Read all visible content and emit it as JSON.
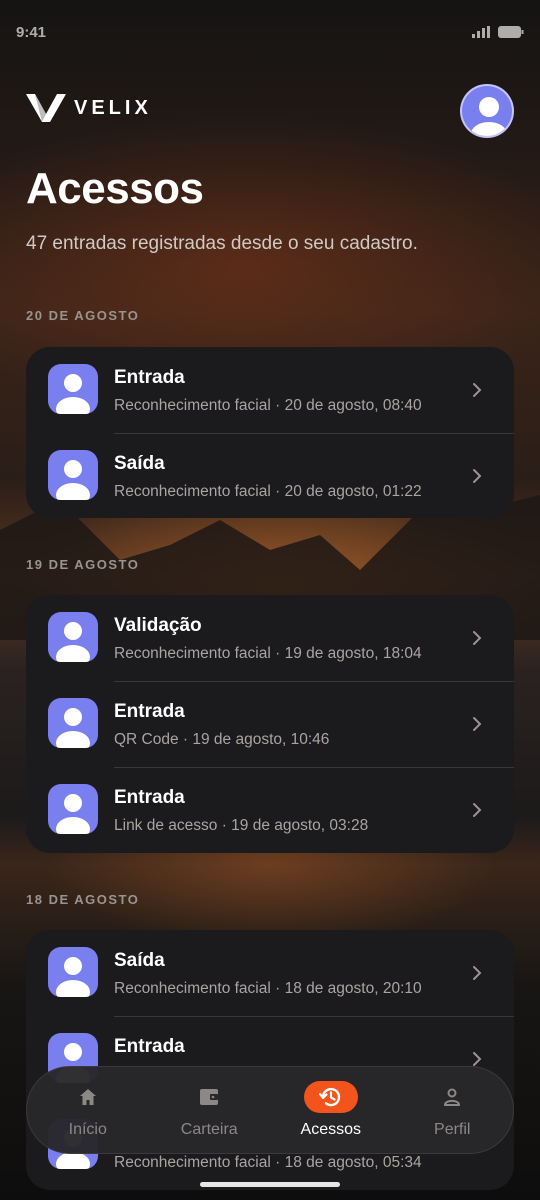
{
  "status": {
    "time": "9:41"
  },
  "brand": {
    "name": "VELIX"
  },
  "header": {
    "title": "Acessos",
    "subtitle": "47 entradas registradas desde o seu cadastro."
  },
  "groups": [
    {
      "label": "20 DE AGOSTO",
      "items": [
        {
          "title": "Entrada",
          "subtitle": "Reconhecimento facial · 20 de agosto, 08:40"
        },
        {
          "title": "Saída",
          "subtitle": "Reconhecimento facial · 20 de agosto, 01:22"
        }
      ]
    },
    {
      "label": "19 DE AGOSTO",
      "items": [
        {
          "title": "Validação",
          "subtitle": "Reconhecimento facial · 19 de agosto, 18:04"
        },
        {
          "title": "Entrada",
          "subtitle": "QR Code · 19 de agosto, 10:46"
        },
        {
          "title": "Entrada",
          "subtitle": "Link de acesso · 19 de agosto, 03:28"
        }
      ]
    },
    {
      "label": "18 DE AGOSTO",
      "items": [
        {
          "title": "Saída",
          "subtitle": "Reconhecimento facial · 18 de agosto, 20:10"
        },
        {
          "title": "Entrada",
          "subtitle": ""
        },
        {
          "title": "",
          "subtitle": "Reconhecimento facial · 18 de agosto, 05:34"
        }
      ]
    }
  ],
  "nav": [
    {
      "label": "Início",
      "icon": "home-icon"
    },
    {
      "label": "Carteira",
      "icon": "wallet-icon"
    },
    {
      "label": "Acessos",
      "icon": "history-icon",
      "active": true
    },
    {
      "label": "Perfil",
      "icon": "person-icon"
    }
  ],
  "colors": {
    "accent": "#f2541b",
    "avatar": "#7a7ff0",
    "card": "#1b1a1c"
  }
}
